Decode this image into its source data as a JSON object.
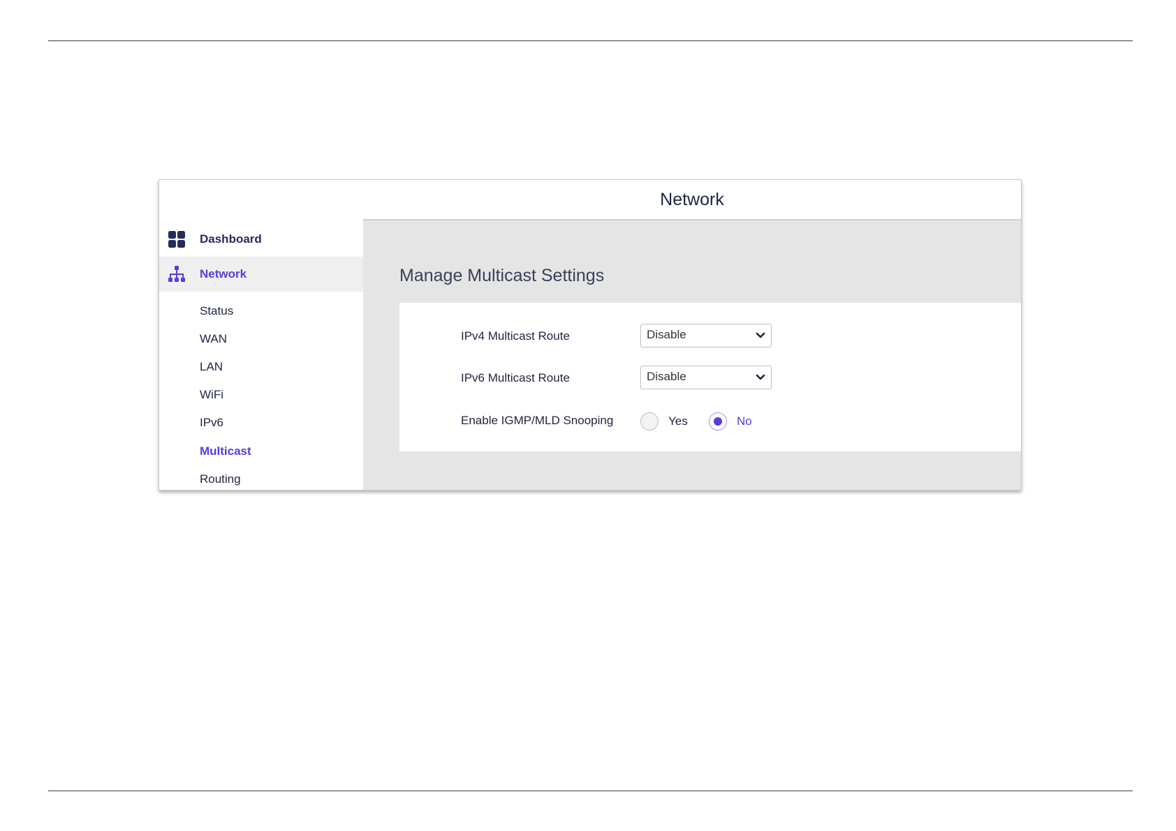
{
  "window": {
    "title": "Network"
  },
  "sidebar": {
    "main_items": [
      {
        "label": "Dashboard",
        "icon": "dashboard-grid-icon"
      },
      {
        "label": "Network",
        "icon": "network-tree-icon",
        "active": true
      }
    ],
    "sub_items": [
      {
        "label": "Status"
      },
      {
        "label": "WAN"
      },
      {
        "label": "LAN"
      },
      {
        "label": "WiFi"
      },
      {
        "label": "IPv6"
      },
      {
        "label": "Multicast",
        "active": true
      },
      {
        "label": "Routing"
      }
    ]
  },
  "main": {
    "section_title": "Manage Multicast Settings",
    "ipv4_route": {
      "label": "IPv4 Multicast Route",
      "value": "Disable"
    },
    "ipv6_route": {
      "label": "IPv6 Multicast Route",
      "value": "Disable"
    },
    "snooping": {
      "label": "Enable IGMP/MLD Snooping",
      "options": [
        "Yes",
        "No"
      ],
      "selected": "No"
    }
  },
  "colors": {
    "accent": "#5c3ae0",
    "nav_text": "#262b5c",
    "content_bg": "#e5e5e5"
  }
}
